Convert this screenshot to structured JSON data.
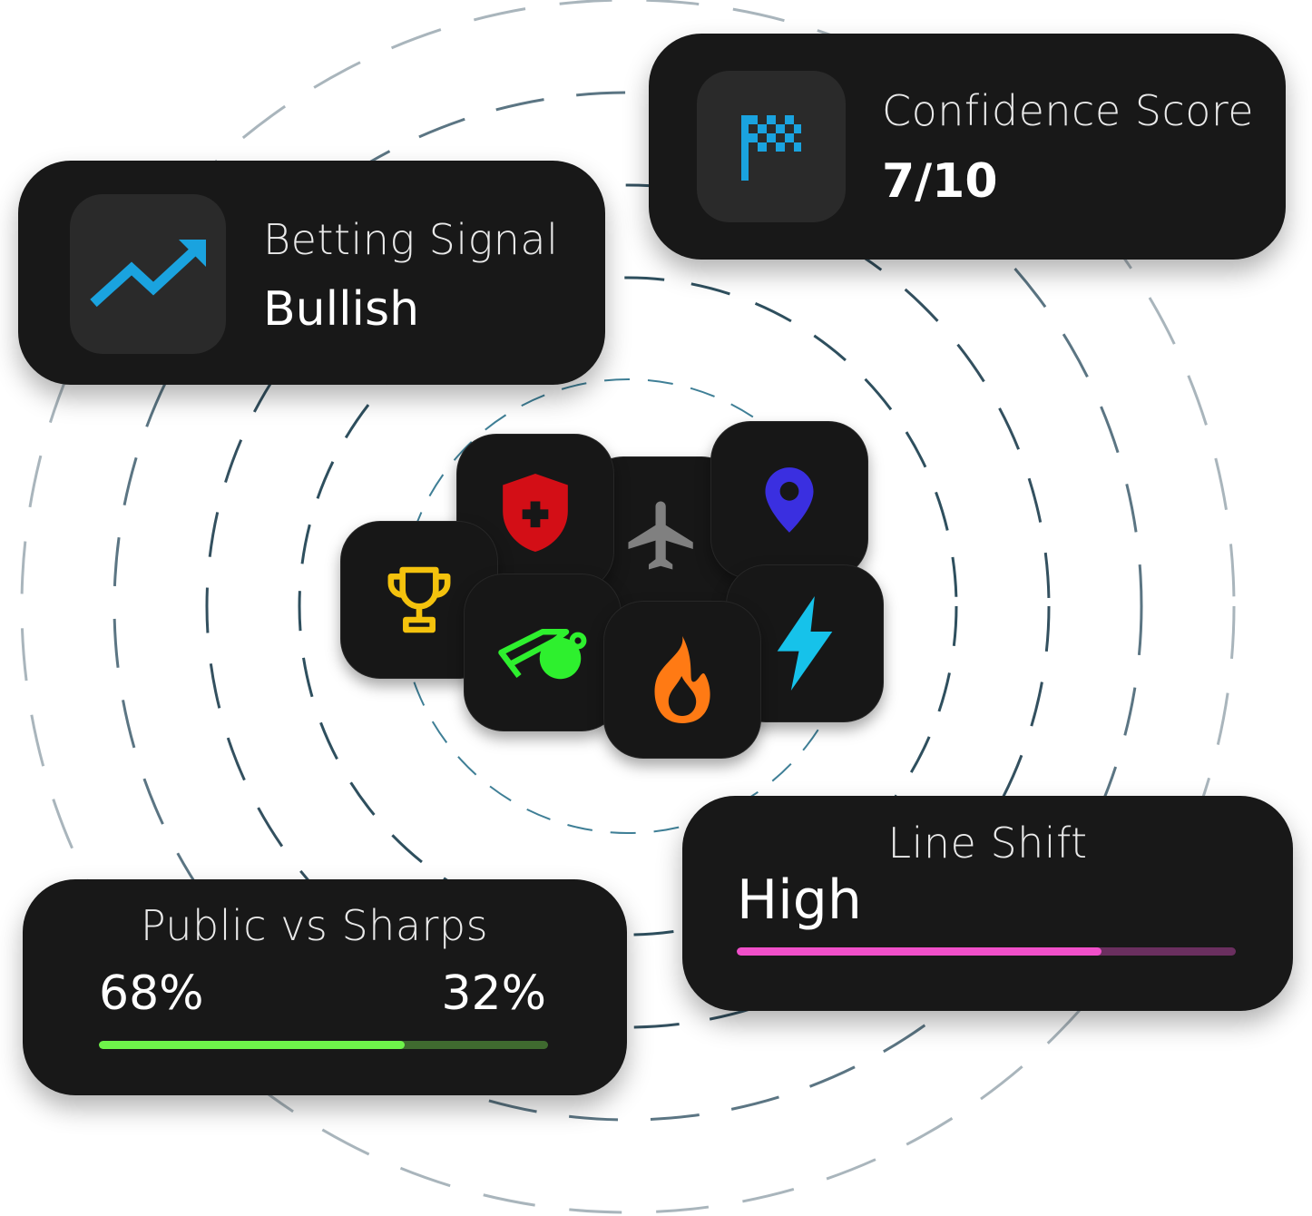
{
  "cards": {
    "betting_signal": {
      "label": "Betting Signal",
      "value": "Bullish",
      "icon": "trending-up-icon"
    },
    "confidence_score": {
      "label": "Confidence Score",
      "value": "7/10",
      "icon": "checkered-flag-icon"
    },
    "public_vs_sharps": {
      "label": "Public vs Sharps",
      "public_value": "68%",
      "sharps_value": "32%",
      "public_fraction": 0.68
    },
    "line_shift": {
      "label": "Line Shift",
      "value": "High",
      "level_fraction": 0.73
    }
  },
  "app_icons": [
    {
      "name": "trophy-icon",
      "color": "#f4c20d"
    },
    {
      "name": "medical-shield-icon",
      "color": "#d30e16"
    },
    {
      "name": "airplane-icon",
      "color": "#808080"
    },
    {
      "name": "location-pin-icon",
      "color": "#3a2fe0"
    },
    {
      "name": "whistle-icon",
      "color": "#2ef02e"
    },
    {
      "name": "flame-icon",
      "color": "#ff7a14"
    },
    {
      "name": "lightning-bolt-icon",
      "color": "#16c2ea"
    }
  ],
  "colors": {
    "card_background": "#181818",
    "accent_blue": "#1aa3df",
    "public_bar": "#6ef34a",
    "sharps_bar": "#3f6a2f",
    "line_shift_bar": "#f04fc9",
    "line_shift_track": "#6a2f5f"
  }
}
